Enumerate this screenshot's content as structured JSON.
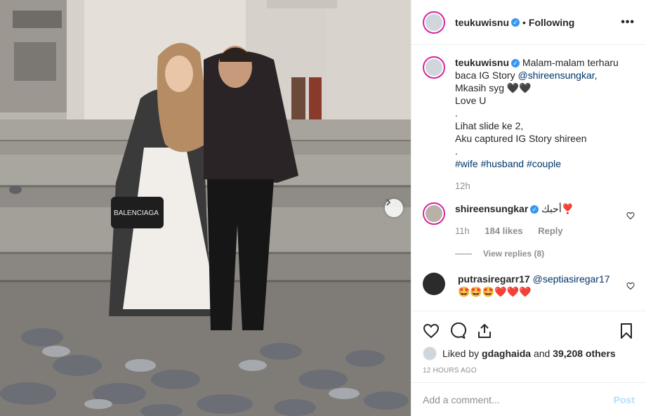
{
  "post": {
    "author": "teukuwisnu",
    "follow_status": "Following",
    "dot": "•",
    "more_label": "•••"
  },
  "caption": {
    "author": "teukuwisnu",
    "lines": [
      "Malam-malam terharu",
      "baca IG Story ",
      "Mkasih syg 🖤🖤",
      "Love U",
      ".",
      "Lihat slide ke 2,",
      "Aku captured IG Story shireen",
      "."
    ],
    "mention": "@shireensungkar",
    "after_mention": ",",
    "hashtags": [
      "#wife",
      "#husband",
      "#couple"
    ],
    "age": "12h"
  },
  "comments": [
    {
      "author": "shireensungkar",
      "text": "أحبك❣️",
      "age": "11h",
      "likes": "184 likes",
      "reply_label": "Reply",
      "view_replies": "View replies (8)"
    },
    {
      "author": "putrasiregarr17",
      "mention": "@septiasiregar17",
      "text": "🤩🤩🤩❤️❤️❤️"
    }
  ],
  "likes": {
    "prefix": "Liked by ",
    "user": "gdaghaida",
    "middle": " and ",
    "count": "39,208 others"
  },
  "timestamp": "12 HOURS AGO",
  "add_comment": {
    "placeholder": "Add a comment...",
    "post_label": "Post"
  },
  "photo": {
    "bag_text": "BALENCIAGA"
  },
  "colors": {
    "verified": "#3897f0",
    "link": "#003569",
    "muted": "#8e8e8e",
    "post_disabled": "#b2dffc",
    "story_ring": "#d6249f"
  },
  "icons": [
    "heart-icon",
    "comment-icon",
    "share-icon",
    "bookmark-icon",
    "more-icon",
    "chevron-right-icon"
  ]
}
